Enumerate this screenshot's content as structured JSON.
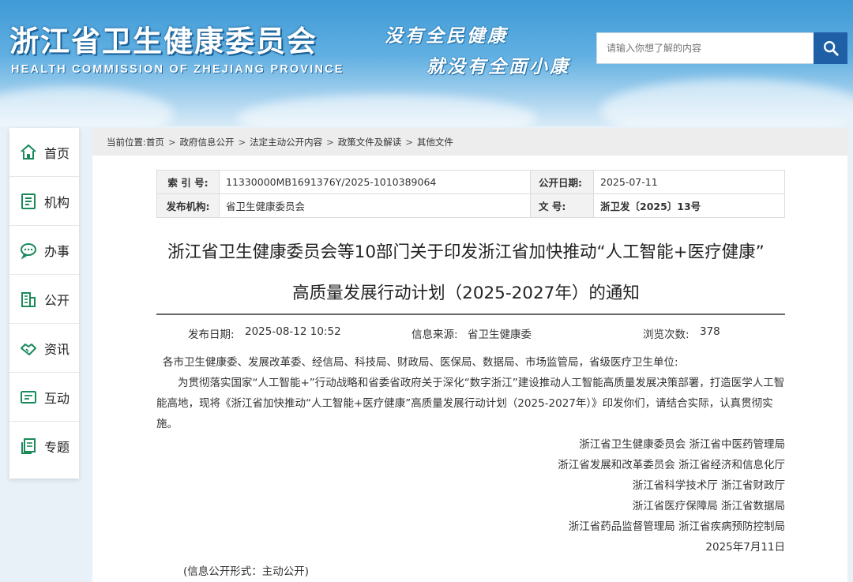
{
  "header": {
    "org_name_cn": "浙江省卫生健康委员会",
    "org_name_en": "HEALTH COMMISSION OF ZHEJIANG PROVINCE",
    "slogan_line1": "没有全民健康",
    "slogan_line2": "就没有全面小康",
    "search": {
      "placeholder": "请输入你想了解的内容",
      "icon": "search-icon"
    }
  },
  "sidebar": {
    "items": [
      {
        "label": "首页",
        "icon": "home-icon"
      },
      {
        "label": "机构",
        "icon": "organization-icon"
      },
      {
        "label": "办事",
        "icon": "chat-bubble-icon"
      },
      {
        "label": "公开",
        "icon": "building-icon"
      },
      {
        "label": "资讯",
        "icon": "handshake-icon"
      },
      {
        "label": "互动",
        "icon": "interaction-icon"
      },
      {
        "label": "专题",
        "icon": "document-stack-icon"
      }
    ]
  },
  "breadcrumb": {
    "prefix": "当前位置:",
    "items": [
      "首页",
      "政府信息公开",
      "法定主动公开内容",
      "政策文件及解读",
      "其他文件"
    ],
    "separator": ">"
  },
  "meta": {
    "index_label": "索 引 号:",
    "index_value": "11330000MB1691376Y/2025-1010389064",
    "pub_date_label": "公开日期:",
    "pub_date_value": "2025-07-11",
    "publisher_label": "发布机构:",
    "publisher_value": "省卫生健康委员会",
    "doc_no_label": "文 号:",
    "doc_no_value": "浙卫发〔2025〕13号"
  },
  "article": {
    "title_line1": "浙江省卫生健康委员会等10部门关于印发浙江省加快推动“人工智能+医疗健康”",
    "title_line2": "高质量发展行动计划（2025-2027年）的通知",
    "release_date_label": "发布日期:",
    "release_date_value": "2025-08-12 10:52",
    "source_label": "信息来源:",
    "source_value": "省卫生健康委",
    "views_label": "浏览次数:",
    "views_value": "378",
    "addressees": "各市卫生健康委、发展改革委、经信局、科技局、财政局、医保局、数据局、市场监管局，省级医疗卫生单位:",
    "body": "为贯彻落实国家“人工智能+”行动战略和省委省政府关于深化“数字浙江”建设推动人工智能高质量发展决策部署，打造医学人工智能高地，现将《浙江省加快推动“人工智能+医疗健康”高质量发展行动计划（2025-2027年）》印发你们，请结合实际，认真贯彻实施。",
    "signers": [
      "浙江省卫生健康委员会 浙江省中医药管理局",
      "浙江省发展和改革委员会 浙江省经济和信息化厅",
      "浙江省科学技术厅 浙江省财政厅",
      "浙江省医疗保障局 浙江省数据局",
      "浙江省药品监督管理局 浙江省疾病预防控制局"
    ],
    "sign_date": "2025年7月11日",
    "disclosure_form": "(信息公开形式：主动公开)"
  },
  "colors": {
    "header_blue": "#3f9ad6",
    "search_button": "#1f5fa6",
    "sidebar_icon": "#1a8a5a",
    "breadcrumb_bg": "#ededed"
  }
}
